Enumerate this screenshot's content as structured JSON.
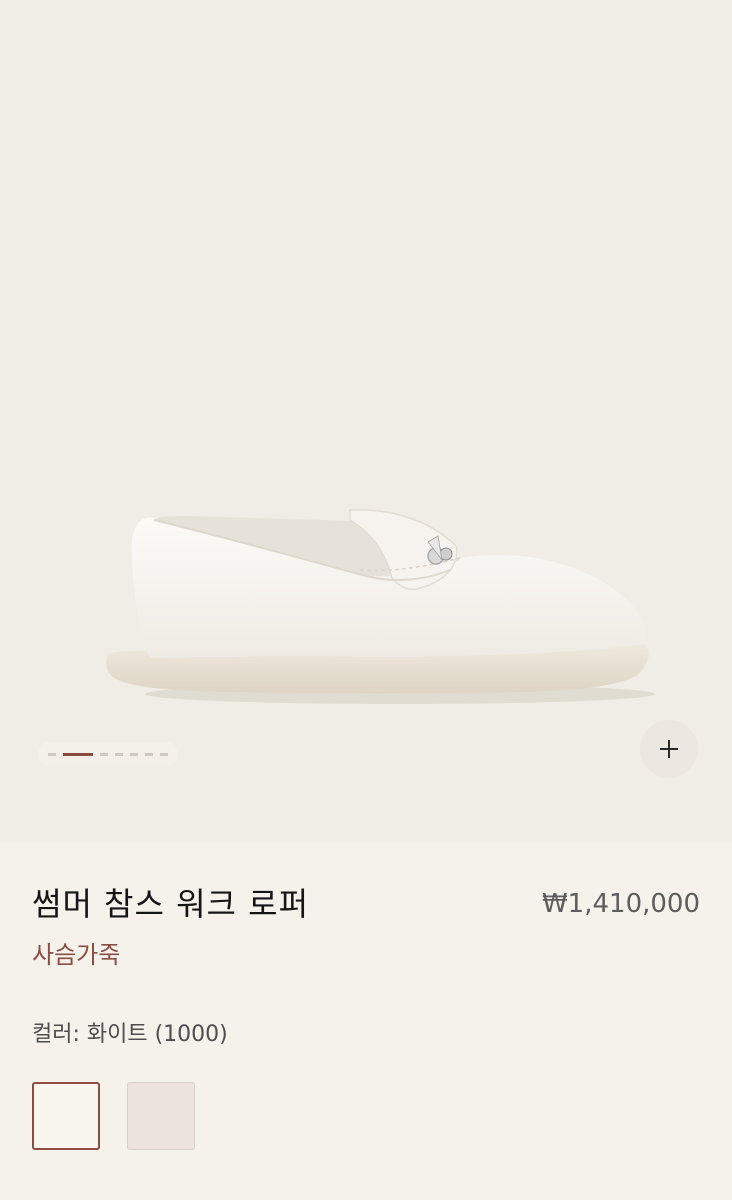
{
  "gallery": {
    "current_slide": 1,
    "total_slides": 7,
    "zoom_icon": "plus-icon"
  },
  "product": {
    "name": "썸머 참스 워크 로퍼",
    "material": "사슴가죽",
    "price": "₩1,410,000"
  },
  "color": {
    "label": "컬러: 화이트 (1000)",
    "options": [
      {
        "name": "white",
        "hex": "#f8f4ee",
        "selected": true
      },
      {
        "name": "beige",
        "hex": "#ece4dc",
        "selected": false
      }
    ]
  },
  "colors": {
    "accent": "#8b4e44",
    "background": "#f5f2ec",
    "gallery_background": "#f0ede6"
  }
}
